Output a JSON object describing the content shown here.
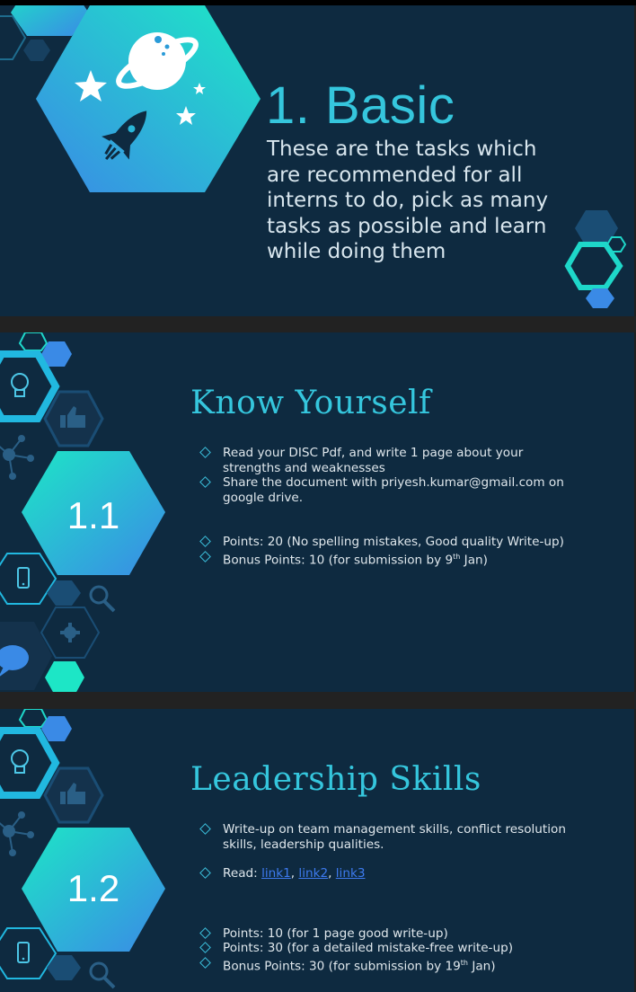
{
  "slide1": {
    "title": "1. Basic",
    "description": "These are the tasks which are recommended for all interns to do, pick as many tasks as possible and learn while doing them"
  },
  "slide2": {
    "number": "1.1",
    "title": "Know Yourself",
    "bullets": [
      "Read your DISC Pdf, and write 1 page about your strengths and weaknesses",
      "Share the document with priyesh.kumar@gmail.com on google drive."
    ],
    "points": "Points: 20 (No spelling mistakes, Good quality Write-up)",
    "bonus_prefix": "Bonus Points: 10 (for submission by 9",
    "bonus_sup": "th",
    "bonus_suffix": " Jan)"
  },
  "slide3": {
    "number": "1.2",
    "title": "Leadership Skills",
    "bullet1": "Write-up on team management skills, conflict resolution skills, leadership qualities.",
    "read_label": "Read: ",
    "links": [
      "link1",
      "link2",
      "link3"
    ],
    "sep": ", ",
    "points1": "Points: 10 (for 1 page good write-up)",
    "points2": "Points: 30 (for a detailed mistake-free write-up)",
    "bonus_prefix": "Bonus Points: 30 (for submission by 19",
    "bonus_sup": "th",
    "bonus_suffix": " Jan)"
  },
  "colors": {
    "background": "#0e2a40",
    "accent": "#35c6dd",
    "link": "#3d7bf0",
    "gradient_start": "#1de0c6",
    "gradient_end": "#3a8ae6"
  },
  "icons": [
    "planet-icon",
    "rocket-icon",
    "star-icon",
    "lightbulb-icon",
    "thumbs-up-icon",
    "network-icon",
    "phone-icon",
    "magnifier-icon",
    "gear-icon",
    "chat-icon"
  ]
}
